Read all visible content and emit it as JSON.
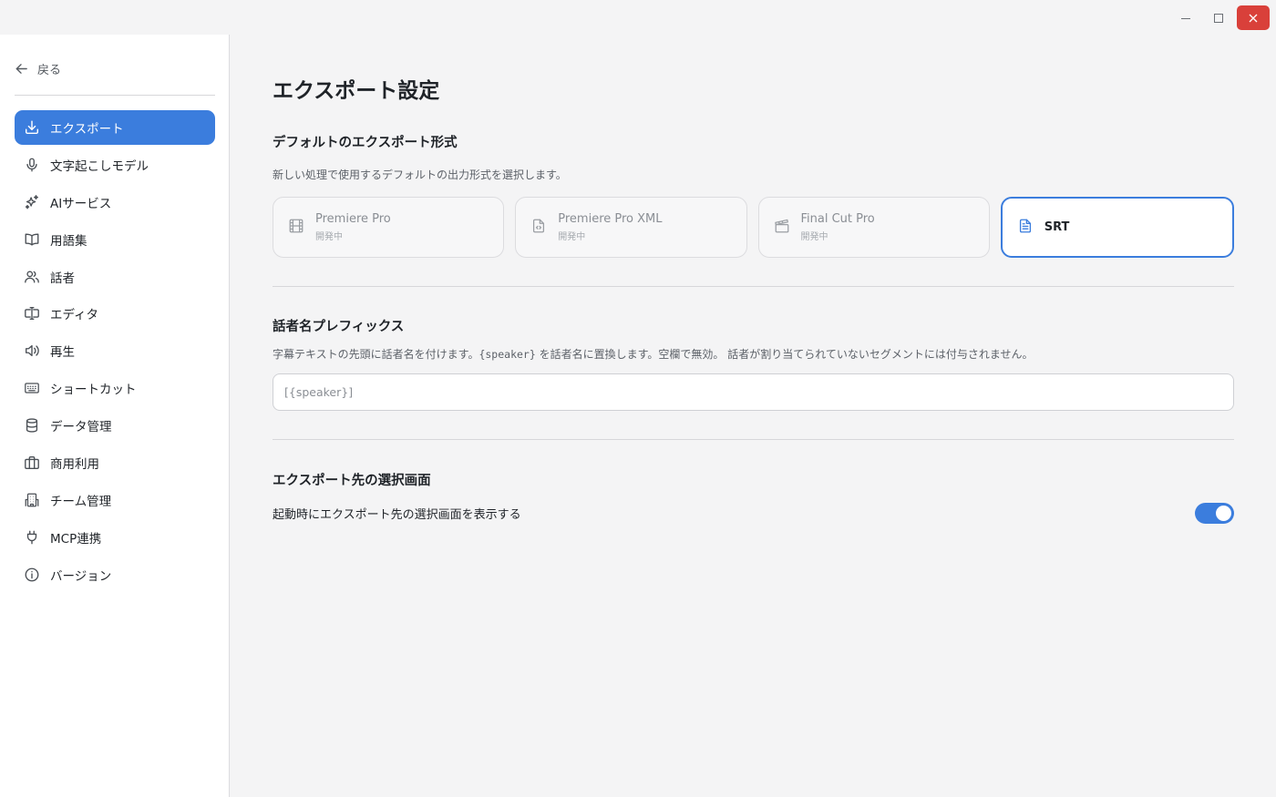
{
  "window": {
    "controls": [
      "minimize-icon",
      "maximize-icon",
      "close-icon"
    ],
    "close_color": "#d9403a"
  },
  "sidebar": {
    "back_label": "戻る",
    "items": [
      {
        "label": "エクスポート",
        "icon": "download-icon",
        "active": true
      },
      {
        "label": "文字起こしモデル",
        "icon": "microphone-icon",
        "active": false
      },
      {
        "label": "AIサービス",
        "icon": "sparkles-icon",
        "active": false
      },
      {
        "label": "用語集",
        "icon": "book-icon",
        "active": false
      },
      {
        "label": "話者",
        "icon": "users-icon",
        "active": false
      },
      {
        "label": "エディタ",
        "icon": "text-cursor-icon",
        "active": false
      },
      {
        "label": "再生",
        "icon": "speaker-icon",
        "active": false
      },
      {
        "label": "ショートカット",
        "icon": "keyboard-icon",
        "active": false
      },
      {
        "label": "データ管理",
        "icon": "database-icon",
        "active": false
      },
      {
        "label": "商用利用",
        "icon": "briefcase-icon",
        "active": false
      },
      {
        "label": "チーム管理",
        "icon": "building-icon",
        "active": false
      },
      {
        "label": "MCP連携",
        "icon": "plug-icon",
        "active": false
      },
      {
        "label": "バージョン",
        "icon": "info-icon",
        "active": false
      }
    ]
  },
  "main": {
    "title": "エクスポート設定",
    "default_format": {
      "title": "デフォルトのエクスポート形式",
      "description": "新しい処理で使用するデフォルトの出力形式を選択します。",
      "options": [
        {
          "label": "Premiere Pro",
          "sub": "開発中",
          "icon": "film-icon",
          "selected": false
        },
        {
          "label": "Premiere Pro XML",
          "sub": "開発中",
          "icon": "code-file-icon",
          "selected": false
        },
        {
          "label": "Final Cut Pro",
          "sub": "開発中",
          "icon": "clapperboard-icon",
          "selected": false
        },
        {
          "label": "SRT",
          "sub": "",
          "icon": "text-file-icon",
          "selected": true
        }
      ]
    },
    "speaker_prefix": {
      "title": "話者名プレフィックス",
      "description_before": "字幕テキストの先頭に話者名を付けます。",
      "description_code": "{speaker}",
      "description_after": " を話者名に置換します。空欄で無効。 話者が割り当てられていないセグメントには付与されません。",
      "value": "",
      "placeholder": "[{speaker}]"
    },
    "destination": {
      "title": "エクスポート先の選択画面",
      "toggle_label": "起動時にエクスポート先の選択画面を表示する",
      "toggle_on": true
    }
  },
  "colors": {
    "accent": "#3b7ddd",
    "background": "#f4f4f5"
  }
}
